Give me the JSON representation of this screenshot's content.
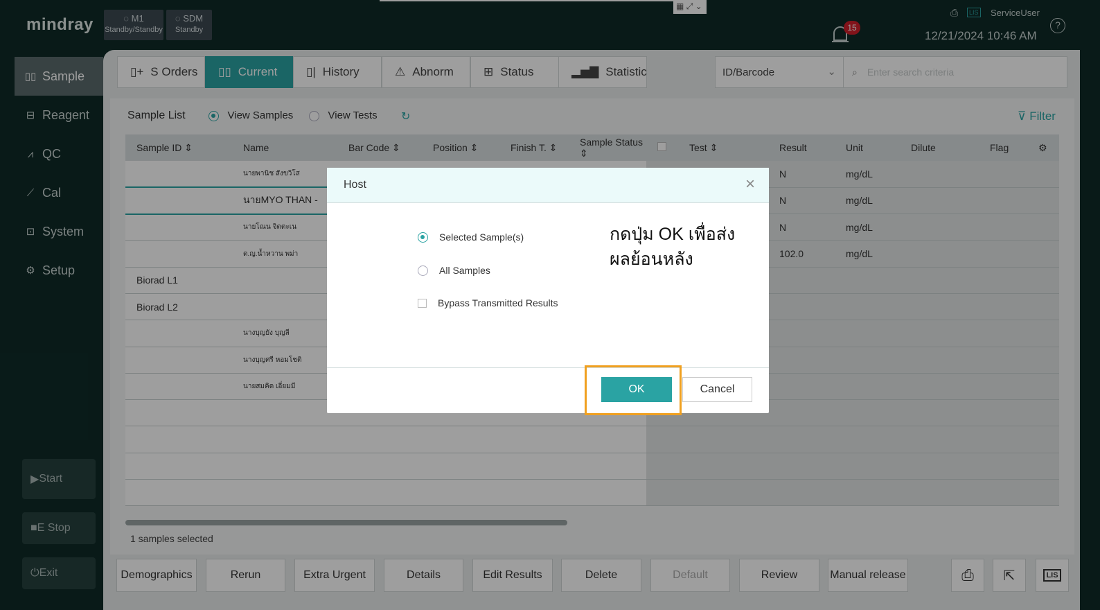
{
  "header": {
    "logo": "mindray",
    "modules": [
      {
        "name": "M1",
        "status": "Standby/Standby"
      },
      {
        "name": "SDM",
        "status": "Standby"
      }
    ],
    "alarm_count": "15",
    "user": "ServiceUser",
    "lis_badge": "LIS",
    "datetime": "12/21/2024 10:46 AM",
    "help": "?"
  },
  "sidebar": {
    "items": [
      {
        "label": "Sample",
        "icon": "sample-icon"
      },
      {
        "label": "Reagent",
        "icon": "reagent-icon"
      },
      {
        "label": "QC",
        "icon": "qc-icon"
      },
      {
        "label": "Cal",
        "icon": "cal-icon"
      },
      {
        "label": "System",
        "icon": "system-icon"
      },
      {
        "label": "Setup",
        "icon": "gear-icon"
      }
    ],
    "start": "Start",
    "estop": "E Stop",
    "exit": "Exit"
  },
  "tabs": [
    "S Orders",
    "Current",
    "History",
    "Abnorm",
    "Status",
    "Statistic"
  ],
  "search": {
    "selected": "ID/Barcode",
    "placeholder": "Enter search criteria"
  },
  "list": {
    "title": "Sample List",
    "view_samples": "View Samples",
    "view_tests": "View Tests",
    "filter": "Filter"
  },
  "left_table": {
    "headers": [
      "Sample ID",
      "Name",
      "Bar Code",
      "Position",
      "Finish T.",
      "Sample Status"
    ],
    "rows": [
      {
        "id": "",
        "name": "นายพานิช สังขวิโส"
      },
      {
        "id": "",
        "name": "นายMYO THAN -"
      },
      {
        "id": "",
        "name": "นายโณน จิตตะเน"
      },
      {
        "id": "",
        "name": "ด.ญ.น้ำหวาน พม่า"
      },
      {
        "id": "Biorad L1",
        "name": ""
      },
      {
        "id": "Biorad L2",
        "name": ""
      },
      {
        "id": "",
        "name": "นางบุญยัง บุญลี"
      },
      {
        "id": "",
        "name": "นางบุญศรี หอมโชติ"
      },
      {
        "id": "",
        "name": "นายสมคิด เอี่ยมมี"
      },
      {
        "id": "",
        "name": ""
      },
      {
        "id": "",
        "name": ""
      },
      {
        "id": "",
        "name": ""
      },
      {
        "id": "",
        "name": ""
      }
    ]
  },
  "right_table": {
    "headers": [
      "Test",
      "Result",
      "Unit",
      "Dilute",
      "Flag"
    ],
    "rows": [
      {
        "result": "N",
        "unit": "mg/dL"
      },
      {
        "result": "N",
        "unit": "mg/dL"
      },
      {
        "result": "N",
        "unit": "mg/dL"
      },
      {
        "result": "102.0",
        "unit": "mg/dL"
      },
      {
        "result": "",
        "unit": ""
      },
      {
        "result": "",
        "unit": ""
      },
      {
        "result": "",
        "unit": ""
      },
      {
        "result": "",
        "unit": ""
      },
      {
        "result": "",
        "unit": ""
      },
      {
        "result": "",
        "unit": ""
      },
      {
        "result": "",
        "unit": ""
      },
      {
        "result": "",
        "unit": ""
      },
      {
        "result": "",
        "unit": ""
      }
    ]
  },
  "selection": "1 samples selected",
  "buttons": [
    "Demographics",
    "Rerun",
    "Extra Urgent",
    "Details",
    "Edit Results",
    "Delete",
    "Default",
    "Review",
    "Manual release"
  ],
  "dialog": {
    "title": "Host",
    "options": [
      "Selected Sample(s)",
      "All Samples"
    ],
    "checkbox": "Bypass Transmitted Results",
    "note_line1": "กดปุ่ม OK เพื่อส่ง",
    "note_line2": "ผลย้อนหลัง",
    "ok": "OK",
    "cancel": "Cancel"
  },
  "colors": {
    "accent": "#2aa3a3",
    "highlight": "#f0a020",
    "alarm": "#d0202a"
  }
}
